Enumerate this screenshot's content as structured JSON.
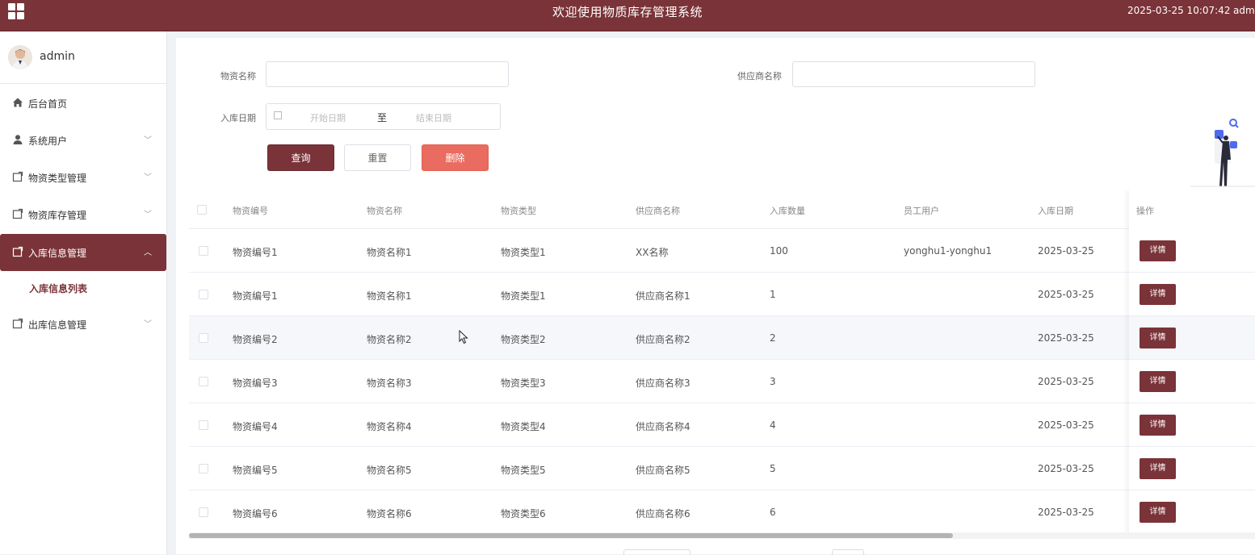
{
  "header": {
    "title": "欢迎使用物质库存管理系统",
    "datetime": "2025-03-25 10:07:42",
    "user": "adm"
  },
  "sidebar": {
    "username": "admin",
    "items": [
      {
        "label": "后台首页",
        "icon": "home-icon",
        "expandable": false
      },
      {
        "label": "系统用户",
        "icon": "user-icon",
        "expandable": true
      },
      {
        "label": "物资类型管理",
        "icon": "folder-icon",
        "expandable": true
      },
      {
        "label": "物资库存管理",
        "icon": "folder-icon",
        "expandable": true
      },
      {
        "label": "入库信息管理",
        "icon": "folder-icon",
        "expandable": true,
        "active": true
      },
      {
        "label": "出库信息管理",
        "icon": "folder-icon",
        "expandable": true
      }
    ],
    "submenu": {
      "label": "入库信息列表"
    }
  },
  "filters": {
    "name_label": "物资名称",
    "name_value": "",
    "supplier_label": "供应商名称",
    "supplier_value": "",
    "date_label": "入库日期",
    "date_start_placeholder": "开始日期",
    "date_separator": "至",
    "date_end_placeholder": "结束日期"
  },
  "actions": {
    "query": "查询",
    "reset": "重置",
    "delete": "删除"
  },
  "table": {
    "columns": [
      "物资编号",
      "物资名称",
      "物资类型",
      "供应商名称",
      "入库数量",
      "员工用户",
      "入库日期",
      "操作"
    ],
    "detail_label": "详情",
    "rows": [
      [
        "物资编号1",
        "物资名称1",
        "物资类型1",
        "XX名称",
        "100",
        "yonghu1-yonghu1",
        "2025-03-25"
      ],
      [
        "物资编号1",
        "物资名称1",
        "物资类型1",
        "供应商名称1",
        "1",
        "",
        "2025-03-25"
      ],
      [
        "物资编号2",
        "物资名称2",
        "物资类型2",
        "供应商名称2",
        "2",
        "",
        "2025-03-25"
      ],
      [
        "物资编号3",
        "物资名称3",
        "物资类型3",
        "供应商名称3",
        "3",
        "",
        "2025-03-25"
      ],
      [
        "物资编号4",
        "物资名称4",
        "物资类型4",
        "供应商名称4",
        "4",
        "",
        "2025-03-25"
      ],
      [
        "物资编号5",
        "物资名称5",
        "物资类型5",
        "供应商名称5",
        "5",
        "",
        "2025-03-25"
      ],
      [
        "物资编号6",
        "物资名称6",
        "物资类型6",
        "供应商名称6",
        "6",
        "",
        "2025-03-25"
      ]
    ],
    "hover_row": 2
  },
  "colors": {
    "primary": "#7a3338",
    "danger": "#ea6b5f",
    "accent_illustration": "#4f6bed"
  }
}
